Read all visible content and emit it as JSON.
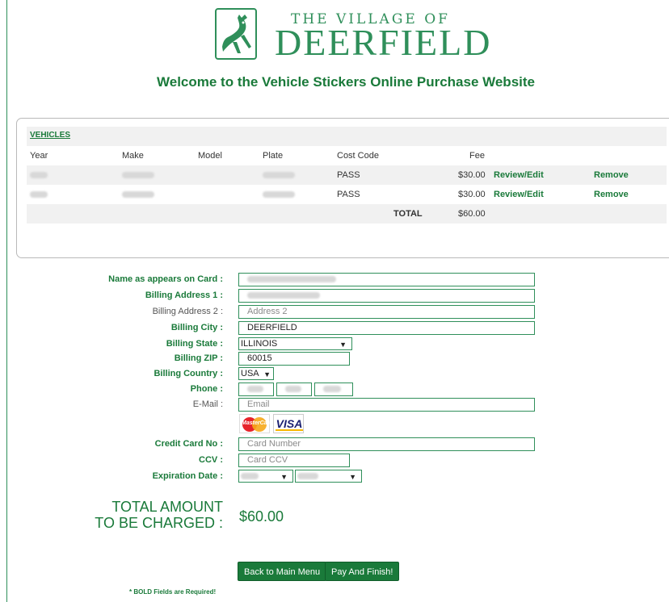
{
  "header": {
    "logo_top": "THE VILLAGE OF",
    "logo_main": "DEERFIELD",
    "welcome": "Welcome to the Vehicle Stickers Online Purchase Website"
  },
  "vehicles": {
    "title": "VEHICLES",
    "columns": [
      "Year",
      "Make",
      "Model",
      "Plate",
      "Cost Code",
      "Fee"
    ],
    "rows": [
      {
        "cost_code": "PASS",
        "fee": "$30.00",
        "edit": "Review/Edit",
        "remove": "Remove"
      },
      {
        "cost_code": "PASS",
        "fee": "$30.00",
        "edit": "Review/Edit",
        "remove": "Remove"
      }
    ],
    "total_label": "TOTAL",
    "total_value": "$60.00"
  },
  "form": {
    "name_label": "Name as appears on Card :",
    "addr1_label": "Billing Address 1 :",
    "addr2_label": "Billing Address 2 :",
    "addr2_placeholder": "Address 2",
    "city_label": "Billing City :",
    "city_value": "DEERFIELD",
    "state_label": "Billing State :",
    "state_value": "ILLINOIS",
    "zip_label": "Billing ZIP :",
    "zip_value": "60015",
    "country_label": "Billing Country :",
    "country_value": "USA",
    "phone_label": "Phone :",
    "email_label": "E-Mail :",
    "email_placeholder": "Email",
    "card_brands": [
      "MasterCard",
      "VISA"
    ],
    "cc_label": "Credit Card No :",
    "cc_placeholder": "Card Number",
    "ccv_label": "CCV :",
    "ccv_placeholder": "Card CCV",
    "exp_label": "Expiration Date :"
  },
  "total": {
    "label_line1": "TOTAL AMOUNT",
    "label_line2": "TO BE CHARGED :",
    "value": "$60.00"
  },
  "buttons": {
    "back": "Back to Main Menu",
    "pay": "Pay And Finish!"
  },
  "note": "* BOLD Fields are Required!",
  "colors": {
    "brand_green": "#1a7a3a",
    "border_green": "#2f8f5a"
  }
}
